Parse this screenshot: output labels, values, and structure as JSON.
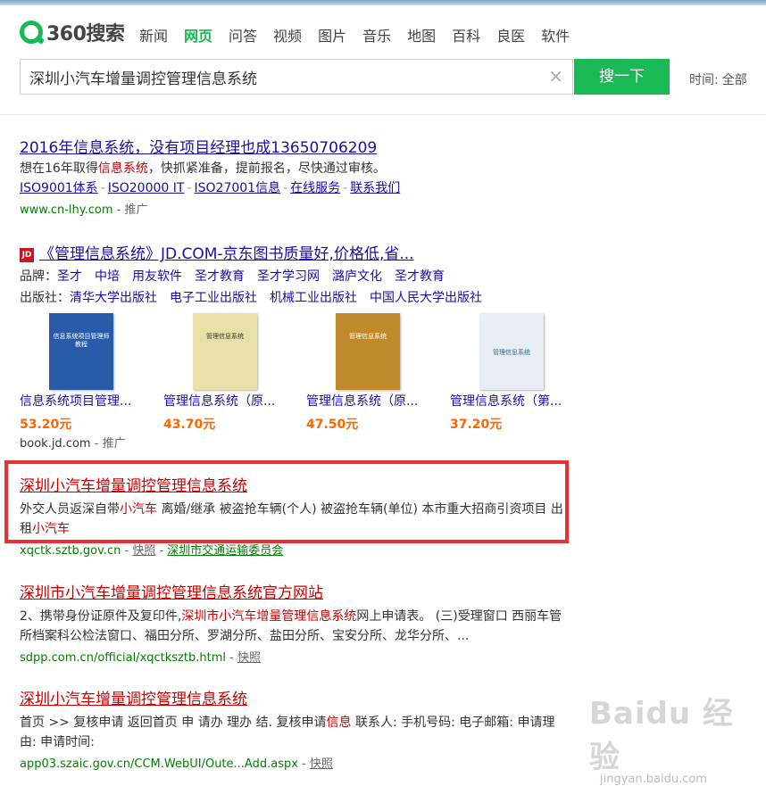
{
  "header": {
    "logo_text": "360搜索",
    "nav": [
      "新闻",
      "网页",
      "问答",
      "视频",
      "图片",
      "音乐",
      "地图",
      "百科",
      "良医",
      "软件"
    ],
    "active_nav": "网页",
    "search_value": "深圳小汽车增量调控管理信息系统",
    "clear_symbol": "×",
    "search_button": "搜一下",
    "time_label": "时间:",
    "time_value": "全部"
  },
  "result1": {
    "title": "2016年信息系统，没有项目经理也成13650706209",
    "desc_pre": "想在16年取得",
    "desc_hl": "信息系统",
    "desc_post": "，快抓紧准备，提前报名，尽快通过审核。",
    "links": [
      "ISO9001体系",
      "ISO20000 IT",
      "ISO27001信息",
      "在线服务",
      "联系我们"
    ],
    "url": "www.cn-lhy.com",
    "tag": "推广"
  },
  "result2": {
    "badge": "JD",
    "title": "《管理信息系统》JD.COM-京东图书质量好,价格低,省...",
    "brand_label": "品牌：",
    "brands": [
      "圣才",
      "中培",
      "用友软件",
      "圣才教育",
      "圣才学习网",
      "潞庐文化",
      "圣才教育"
    ],
    "publisher_label": "出版社：",
    "publishers": [
      "清华大学出版社",
      "电子工业出版社",
      "机械工业出版社",
      "中国人民大学出版社"
    ],
    "books": [
      {
        "name": "信息系统项目管理...",
        "price": "53.20元",
        "cover_text": "信息系统项目管理师教程",
        "color": "#2a5ba8"
      },
      {
        "name": "管理信息系统（原...",
        "price": "43.70元",
        "cover_text": "管理信息系统",
        "color": "#e9dfa9"
      },
      {
        "name": "管理信息系统（原...",
        "price": "47.50元",
        "cover_text": "管理信息系统",
        "color": "#c08a2a"
      },
      {
        "name": "管理信息系统（第...",
        "price": "37.20元",
        "cover_text": "管理信息系统",
        "color": "#e8eef4"
      }
    ],
    "url": "book.jd.com",
    "tag": "推广"
  },
  "result3": {
    "title": "深圳小汽车增量调控管理信息系统",
    "desc_a": "外交人员返深自带",
    "desc_hl1": "小汽车",
    "desc_b": " 离婚/继承 被盗抢车辆(个人) 被盗抢车辆(单位) 本市重大招商引资项目 出租",
    "desc_hl2": "小汽车",
    "url": "xqctk.sztb.gov.cn",
    "snapshot": "快照",
    "extra": "深圳市交通运输委员会"
  },
  "result4": {
    "title": "深圳市小汽车增量调控管理信息系统官方网站",
    "desc_a": "2、携带身份证原件及复印件,",
    "desc_hl": "深圳市小汽车增量管理信息系统",
    "desc_b": "网上申请表。 (三)受理窗口 西丽车管所档案科公检法窗口、福田分所、罗湖分所、盐田分所、宝安分所、龙华分所、...",
    "url": "sdpp.com.cn/official/xqctksztb.html",
    "snapshot": "快照"
  },
  "result5": {
    "title": "深圳小汽车增量调控管理信息系统",
    "desc_a": "首页 >> 复核申请 返回首页 申 请办 理办 结. 复核申请",
    "desc_hl": "信息",
    "desc_b": " 联系人: 手机号码: 电子邮箱: 申请理由: 申请时间:",
    "url": "app03.szaic.gov.cn/CCM.WebUI/Oute...Add.aspx",
    "snapshot": "快照"
  },
  "watermark": {
    "main": "Baidu 经验",
    "sub": "jingyan.baidu.com"
  },
  "colors": {
    "brand_green": "#19b955",
    "link_blue": "#1a0dab",
    "highlight_red": "#cc0000",
    "url_green": "#008000",
    "box_red": "#ec2f34",
    "price_orange": "#ff6600"
  }
}
